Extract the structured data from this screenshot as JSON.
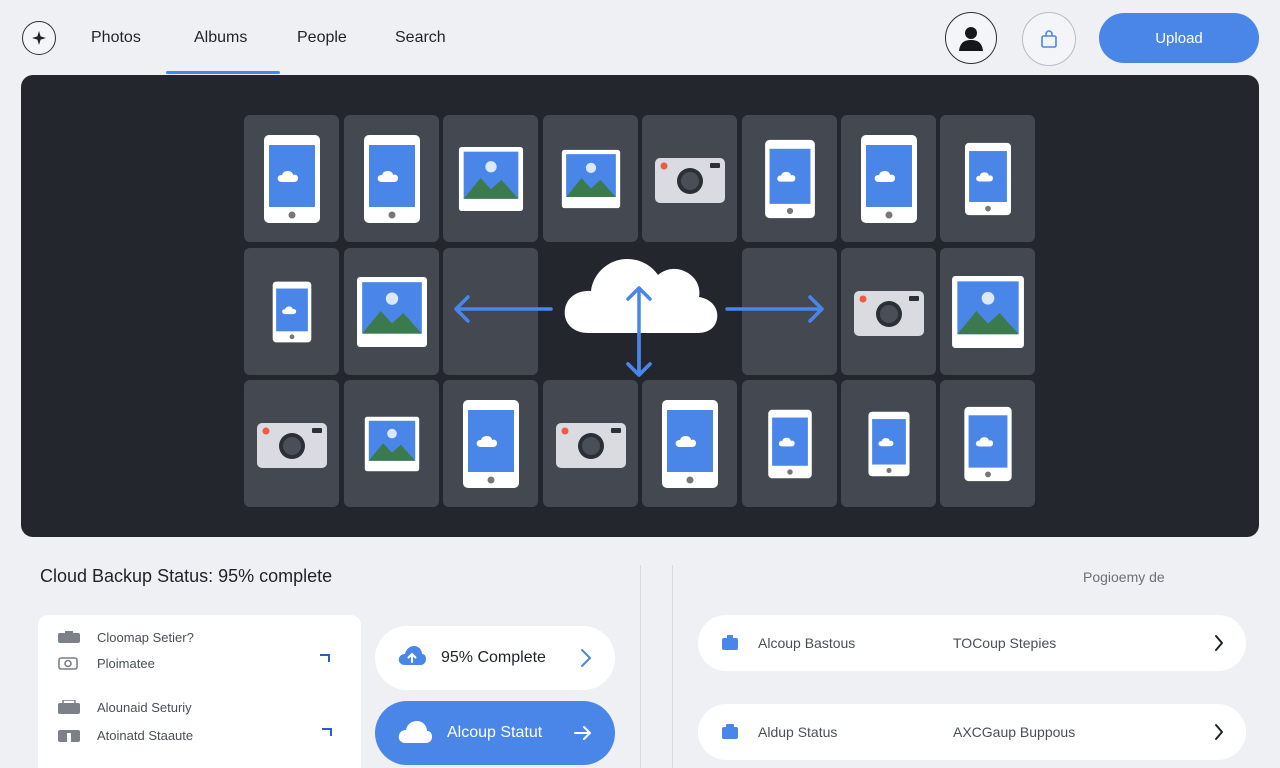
{
  "nav": {
    "links": [
      "Photos",
      "Albums",
      "People",
      "Search"
    ],
    "active": "Albums",
    "upload_label": "Upload"
  },
  "hero": {
    "description_icons": [
      "phone-icon",
      "photo-icon",
      "camera-icon",
      "cloud-icon",
      "arrow-icon"
    ]
  },
  "status": {
    "title": "Cloud Backup Status: 95% complete",
    "right_label": "Pogioemy de"
  },
  "list_card": {
    "rows": [
      "Cloomap Setier?",
      "Ploimatee",
      "Alounaid Seturiy",
      "Atoinatd Staaute"
    ]
  },
  "pills": {
    "complete_label": "95% Complete",
    "action_label": "Alcoup Statut"
  },
  "right_rows": [
    {
      "left": "Alcoup Bastous",
      "right": "TOCoup Stepies"
    },
    {
      "left": "Aldup  Status",
      "right": "AXCGaup Buppous"
    }
  ],
  "colors": {
    "accent": "#4a86e8",
    "hero_bg": "#23262d",
    "tile": "#434851",
    "page_bg": "#eef0f4"
  }
}
